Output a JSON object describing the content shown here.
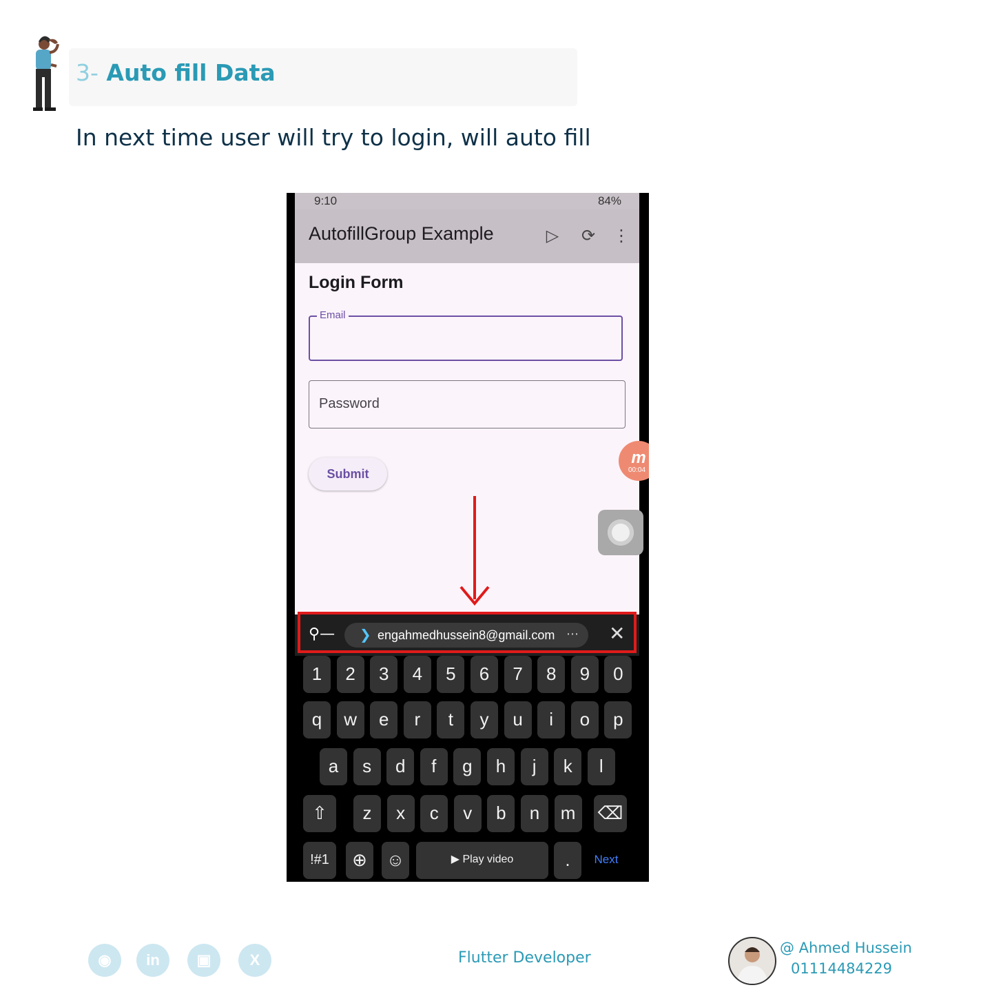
{
  "header": {
    "number": "3-",
    "title": "Auto fill Data",
    "subtitle": "In next time user will try to login, will auto fill"
  },
  "phone": {
    "status": {
      "time": "9:10",
      "battery": "84%"
    },
    "app_title": "AutofillGroup Example",
    "form_title": "Login Form",
    "email_label": "Email",
    "password_placeholder": "Password",
    "submit_label": "Submit",
    "recording_time": "00:04",
    "autofill_suggestion": "engahmedhussein8@gmail.com",
    "keyboard": {
      "row1": [
        "1",
        "2",
        "3",
        "4",
        "5",
        "6",
        "7",
        "8",
        "9",
        "0"
      ],
      "row2": [
        "q",
        "w",
        "e",
        "r",
        "t",
        "y",
        "u",
        "i",
        "o",
        "p"
      ],
      "row3": [
        "a",
        "s",
        "d",
        "f",
        "g",
        "h",
        "j",
        "k",
        "l"
      ],
      "row4": [
        "z",
        "x",
        "c",
        "v",
        "b",
        "n",
        "m"
      ],
      "symbols_key": "!#1",
      "play_video": "Play video",
      "period_key": ".",
      "next_key": "Next"
    }
  },
  "footer": {
    "role": "Flutter Developer",
    "author": "@ Ahmed Hussein",
    "phone": "01114484229"
  },
  "colors": {
    "accent": "#2a9ab5",
    "highlight": "#e01b1b",
    "form_accent": "#6b4fa3"
  }
}
